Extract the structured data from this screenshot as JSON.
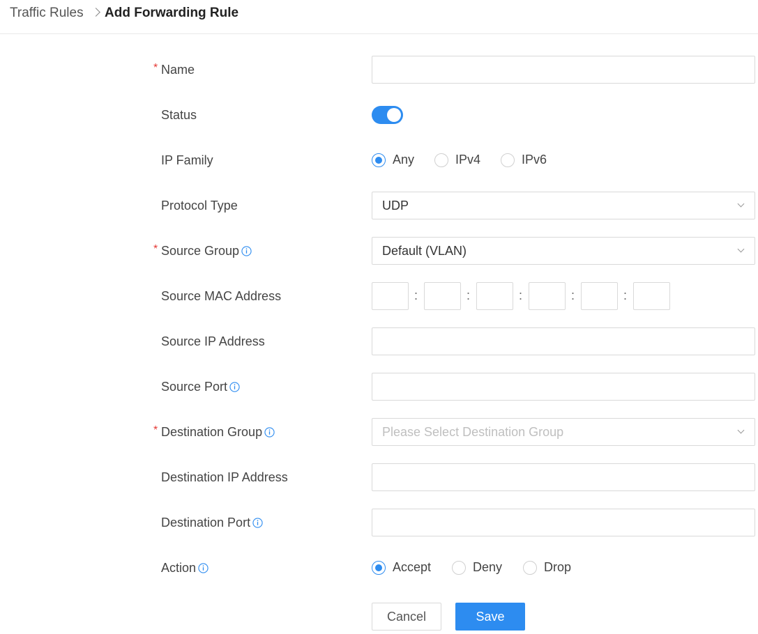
{
  "breadcrumb": {
    "parent": "Traffic Rules",
    "current": "Add Forwarding Rule"
  },
  "form": {
    "name": {
      "label": "Name",
      "required_mark": "*",
      "value": ""
    },
    "status": {
      "label": "Status",
      "enabled": true
    },
    "ip_family": {
      "label": "IP Family",
      "options": [
        "Any",
        "IPv4",
        "IPv6"
      ],
      "selected": "Any"
    },
    "protocol_type": {
      "label": "Protocol Type",
      "value": "UDP"
    },
    "source_group": {
      "label": "Source Group",
      "required_mark": "*",
      "value": "Default (VLAN)"
    },
    "source_mac": {
      "label": "Source MAC Address",
      "separator": ":",
      "octets": [
        "",
        "",
        "",
        "",
        "",
        ""
      ]
    },
    "source_ip": {
      "label": "Source IP Address",
      "value": ""
    },
    "source_port": {
      "label": "Source Port",
      "value": ""
    },
    "destination_group": {
      "label": "Destination Group",
      "required_mark": "*",
      "placeholder": "Please Select Destination Group"
    },
    "destination_ip": {
      "label": "Destination IP Address",
      "value": ""
    },
    "destination_port": {
      "label": "Destination Port",
      "value": ""
    },
    "action": {
      "label": "Action",
      "options": [
        "Accept",
        "Deny",
        "Drop"
      ],
      "selected": "Accept"
    }
  },
  "buttons": {
    "cancel": "Cancel",
    "save": "Save"
  },
  "colors": {
    "accent": "#2d8cf0",
    "required": "#e53935"
  },
  "icons": {
    "info": "info-circle-icon",
    "chevron": "chevron-down-icon",
    "breadcrumb_sep": "chevron-right-icon"
  }
}
